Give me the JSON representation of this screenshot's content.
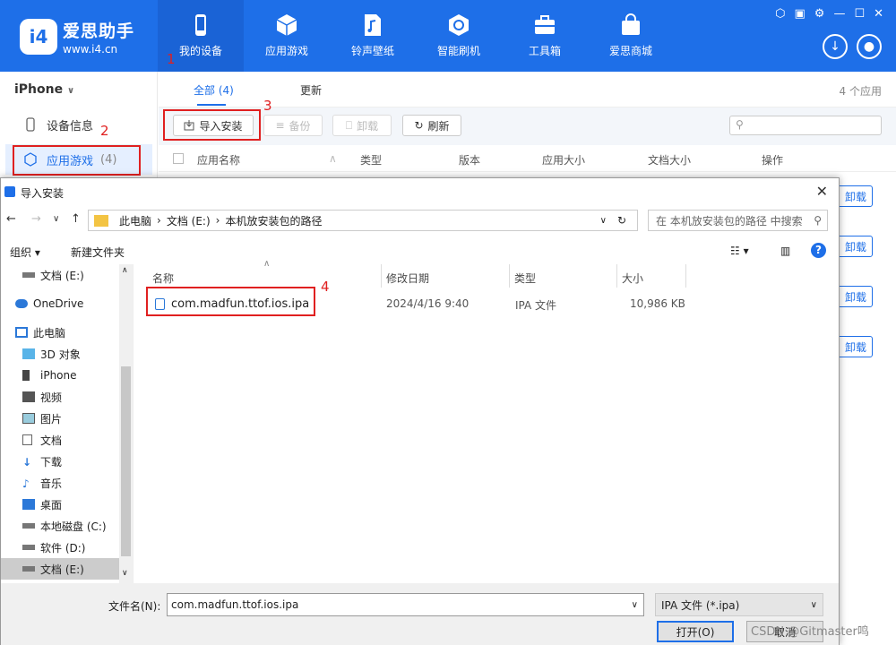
{
  "app": {
    "name": "爱思助手",
    "url": "www.i4.cn",
    "logo_mark": "i4",
    "nav": [
      {
        "label": "我的设备",
        "icon": "phone-icon",
        "active": true
      },
      {
        "label": "应用游戏",
        "icon": "cube-icon"
      },
      {
        "label": "铃声壁纸",
        "icon": "music-file-icon"
      },
      {
        "label": "智能刷机",
        "icon": "refresh-shield-icon"
      },
      {
        "label": "工具箱",
        "icon": "toolbox-icon"
      },
      {
        "label": "爱思商城",
        "icon": "shopping-bag-icon"
      }
    ]
  },
  "sidebar": {
    "device": "iPhone",
    "items": [
      {
        "label": "设备信息",
        "icon": "phone-outline-icon"
      },
      {
        "label": "应用游戏",
        "count": "(4)",
        "icon": "cube-outline-icon",
        "active": true
      }
    ]
  },
  "main": {
    "tabs": [
      "全部 (4)",
      "更新"
    ],
    "app_count": "4 个应用",
    "toolbar": {
      "import": "导入安装",
      "backup": "备份",
      "uninstall": "卸载",
      "refresh": "刷新"
    },
    "columns": [
      "应用名称",
      "类型",
      "版本",
      "应用大小",
      "文档大小",
      "操作"
    ],
    "row_action": "卸载"
  },
  "annotations": [
    "1",
    "2",
    "3",
    "4"
  ],
  "dialog": {
    "title": "导入安装",
    "breadcrumb": [
      "此电脑",
      "文档 (E:)",
      "本机放安装包的路径"
    ],
    "search_placeholder": "在 本机放安装包的路径 中搜索",
    "organize": "组织",
    "new_folder": "新建文件夹",
    "tree": [
      {
        "label": "文档 (E:)",
        "icon": "drive-icon"
      },
      {
        "label": "OneDrive",
        "icon": "cloud-icon"
      },
      {
        "label": "此电脑",
        "icon": "computer-icon"
      },
      {
        "label": "3D 对象",
        "icon": "cube-3d-icon"
      },
      {
        "label": "iPhone",
        "icon": "phone-icon"
      },
      {
        "label": "视频",
        "icon": "video-icon"
      },
      {
        "label": "图片",
        "icon": "picture-icon"
      },
      {
        "label": "文档",
        "icon": "document-icon"
      },
      {
        "label": "下载",
        "icon": "download-icon"
      },
      {
        "label": "音乐",
        "icon": "music-icon"
      },
      {
        "label": "桌面",
        "icon": "desktop-icon"
      },
      {
        "label": "本地磁盘 (C:)",
        "icon": "drive-icon"
      },
      {
        "label": "软件 (D:)",
        "icon": "drive-icon"
      },
      {
        "label": "文档 (E:)",
        "icon": "drive-icon",
        "selected": true
      }
    ],
    "columns": [
      "名称",
      "修改日期",
      "类型",
      "大小"
    ],
    "files": [
      {
        "name": "com.madfun.ttof.ios.ipa",
        "modified": "2024/4/16 9:40",
        "type": "IPA 文件",
        "size": "10,986 KB"
      }
    ],
    "filename_label": "文件名(N):",
    "filename": "com.madfun.ttof.ios.ipa",
    "filter": "IPA 文件 (*.ipa)",
    "open": "打开(O)",
    "cancel": "取消"
  },
  "watermark": "CSDN @Gitmaster鸣",
  "colors": {
    "brand": "#1e6fe8",
    "annotation": "#e02020"
  }
}
